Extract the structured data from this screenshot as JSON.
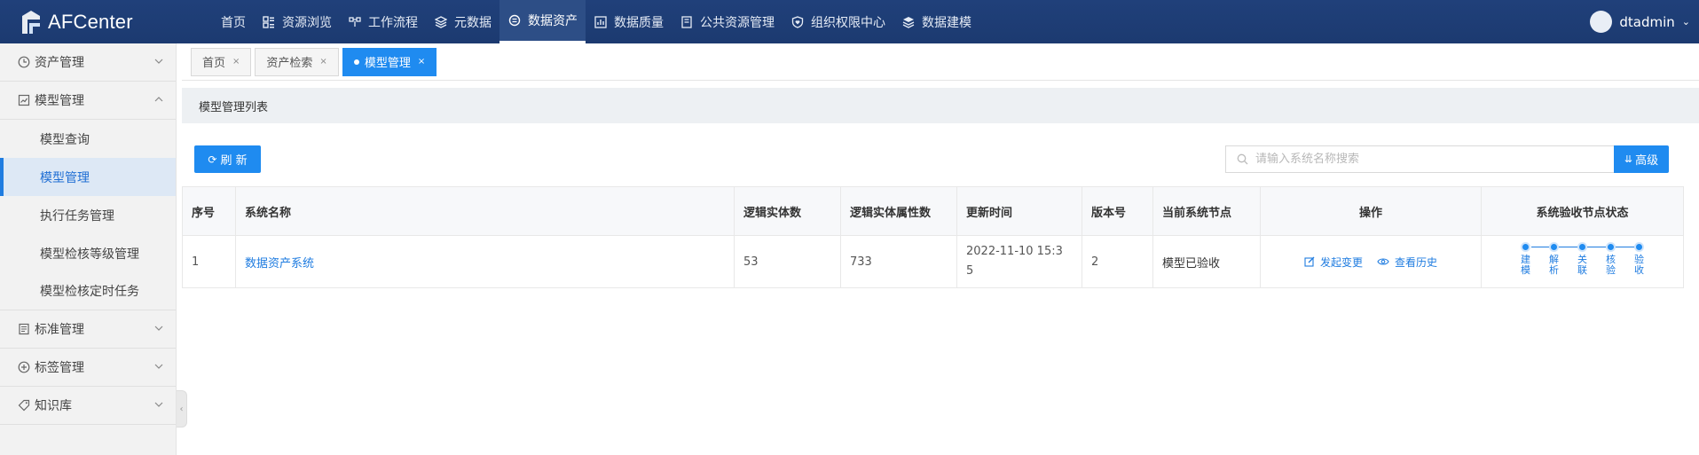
{
  "app": {
    "logo_text": "AFCenter"
  },
  "nav": [
    {
      "label": "首页",
      "icon": "none"
    },
    {
      "label": "资源浏览",
      "icon": "grid-icon"
    },
    {
      "label": "工作流程",
      "icon": "workflow-icon"
    },
    {
      "label": "元数据",
      "icon": "layers-icon"
    },
    {
      "label": "数据资产",
      "icon": "database-icon",
      "active": true
    },
    {
      "label": "数据质量",
      "icon": "bar-chart-icon"
    },
    {
      "label": "公共资源管理",
      "icon": "book-icon"
    },
    {
      "label": "组织权限中心",
      "icon": "shield-heart-icon"
    },
    {
      "label": "数据建模",
      "icon": "layers-icon"
    }
  ],
  "user": {
    "name": "dtadmin"
  },
  "sidebar": {
    "groups": [
      {
        "label": "资产管理",
        "icon": "clock-icon",
        "expanded": false
      },
      {
        "label": "模型管理",
        "icon": "chart-box-icon",
        "expanded": true,
        "items": [
          {
            "label": "模型查询"
          },
          {
            "label": "模型管理",
            "active": true
          },
          {
            "label": "执行任务管理"
          },
          {
            "label": "模型检核等级管理"
          },
          {
            "label": "模型检核定时任务"
          }
        ]
      },
      {
        "label": "标准管理",
        "icon": "document-icon",
        "expanded": false
      },
      {
        "label": "标签管理",
        "icon": "plus-circle-icon",
        "expanded": false
      },
      {
        "label": "知识库",
        "icon": "tag-icon",
        "expanded": false
      }
    ]
  },
  "tabs": [
    {
      "label": "首页",
      "close": "×"
    },
    {
      "label": "资产检索",
      "close": "×"
    },
    {
      "label": "模型管理",
      "close": "×",
      "active": true
    }
  ],
  "panel": {
    "title": "模型管理列表"
  },
  "toolbar": {
    "refresh_label": "刷 新",
    "search_placeholder": "请输入系统名称搜索",
    "advanced_label": "高级"
  },
  "table": {
    "headers": [
      "序号",
      "系统名称",
      "逻辑实体数",
      "逻辑实体属性数",
      "更新时间",
      "版本号",
      "当前系统节点",
      "操作",
      "系统验收节点状态"
    ],
    "rows": [
      {
        "index": "1",
        "system_name": "数据资产系统",
        "entity_count": "53",
        "attribute_count": "733",
        "updated": "2022-11-10 15:35",
        "version": "2",
        "node": "模型已验收",
        "actions": [
          {
            "label": "发起变更",
            "icon": "edit-icon"
          },
          {
            "label": "查看历史",
            "icon": "eye-icon"
          }
        ],
        "steps": [
          "建模",
          "解析",
          "关联",
          "核验",
          "验收"
        ]
      }
    ]
  },
  "colors": {
    "topbar": "#1c3a70",
    "accent": "#1f8bf0",
    "link": "#1f7ce0"
  }
}
